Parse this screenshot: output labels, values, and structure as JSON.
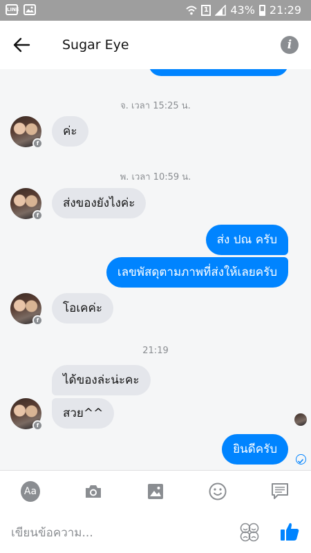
{
  "status_bar": {
    "battery": "43%",
    "time": "21:29"
  },
  "header": {
    "title": "Sugar Eye"
  },
  "messages": {
    "ts1": "จ. เวลา 15:25 น.",
    "m1": "ค่ะ",
    "ts2": "พ. เวลา 10:59 น.",
    "m2": "ส่งของยังไงค่ะ",
    "m3": "ส่ง ปณ ครับ",
    "m4": "เลขพัสดุตามภาพที่ส่งให้เลยครับ",
    "m5": "โอเคค่ะ",
    "ts3": "21:19",
    "m6": "ได้ของล่ะน่ะคะ",
    "m7": "สวย^^",
    "m8": "ยินดีครับ"
  },
  "toolbar": {
    "text_style_label": "Aa"
  },
  "composer": {
    "placeholder": "เขียนข้อความ..."
  },
  "colors": {
    "accent": "#0084ff",
    "incoming_bubble": "#e4e6eb",
    "chat_bg": "#f5f6f7",
    "icon_grey": "#8a8d91",
    "status_bar": "#9e9e9e"
  },
  "icons": [
    "line-icon",
    "gallery-icon",
    "wifi-icon",
    "sim-icon",
    "signal-icon",
    "battery-icon",
    "back-arrow-icon",
    "info-icon",
    "facebook-badge-icon",
    "camera-icon",
    "image-icon",
    "emoji-icon",
    "message-icon",
    "sticker-icon",
    "like-icon",
    "check-icon"
  ]
}
